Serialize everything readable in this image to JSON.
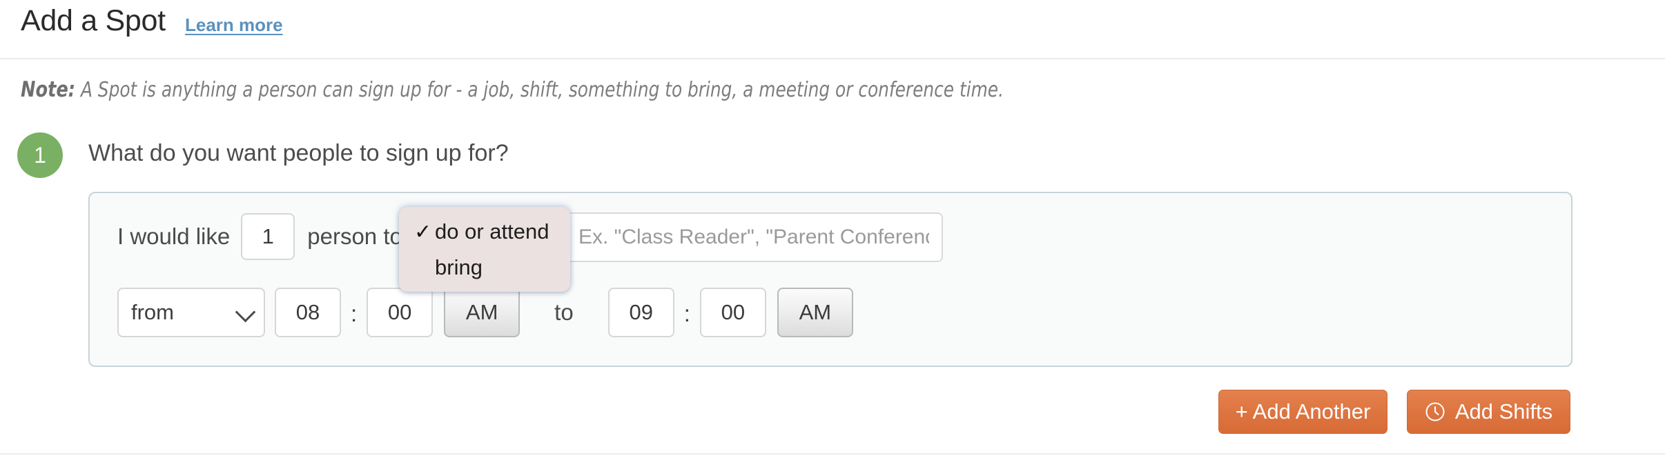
{
  "header": {
    "title": "Add a Spot",
    "learn_more": "Learn more"
  },
  "note": {
    "label": "Note:",
    "text": "A Spot is anything a person can sign up for - a job, shift, something to bring, a meeting or conference time."
  },
  "step": {
    "number": "1",
    "question": "What do you want people to sign up for?",
    "badge_color": "#7ab063"
  },
  "spot_form": {
    "label_i_would_like": "I would like",
    "quantity_value": "1",
    "label_person_to": "person to",
    "verb_selected": "do or attend",
    "title_placeholder": "Ex. \"Class Reader\", \"Parent Conference\"",
    "title_value": "",
    "range_select": "from",
    "start_hour": "08",
    "start_minute": "00",
    "start_meridiem": "AM",
    "label_to": "to",
    "end_hour": "09",
    "end_minute": "00",
    "end_meridiem": "AM",
    "time_separator": ":"
  },
  "dropdown": {
    "open": true,
    "check_glyph": "✓",
    "background": "#ebe1e1",
    "options": [
      {
        "label": "do or attend",
        "selected": true
      },
      {
        "label": "bring",
        "selected": false
      }
    ]
  },
  "actions": {
    "add_another": "+ Add Another",
    "add_shifts": "Add Shifts",
    "accent_color": "#dd7440"
  }
}
